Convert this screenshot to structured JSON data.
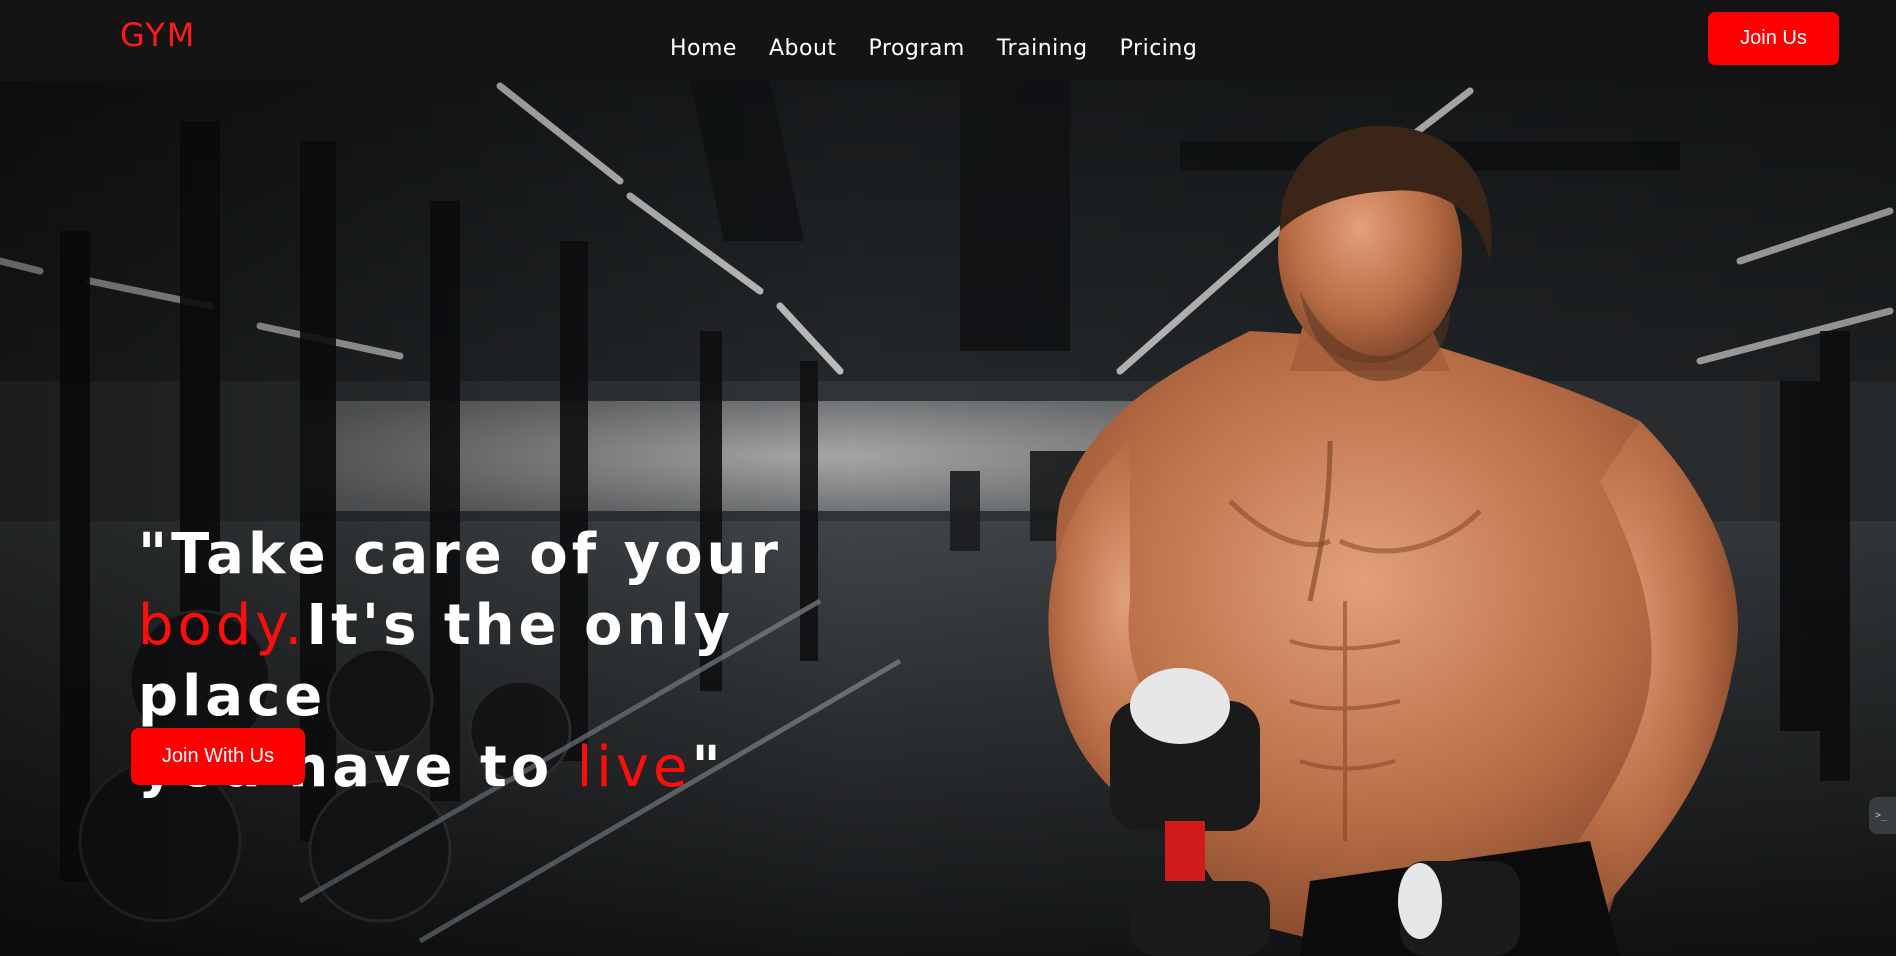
{
  "brand": {
    "logo": "GYM"
  },
  "nav": {
    "links": [
      "Home",
      "About",
      "Program",
      "Training",
      "Pricing"
    ],
    "join_label": "Join Us"
  },
  "hero": {
    "quote_open": "\"Take care of your",
    "accent_body": "body.",
    "line2_rest": "It's the only place",
    "line3_start": "you have to ",
    "accent_live": "live",
    "quote_close": "\"",
    "cta_label": "Join With Us"
  },
  "side_widget": {
    "label": ">_"
  },
  "colors": {
    "accent": "#ff0000",
    "navbar_bg": "#141414",
    "text": "#ffffff"
  },
  "icons": {
    "hero_image": "gym-athlete-photo"
  }
}
